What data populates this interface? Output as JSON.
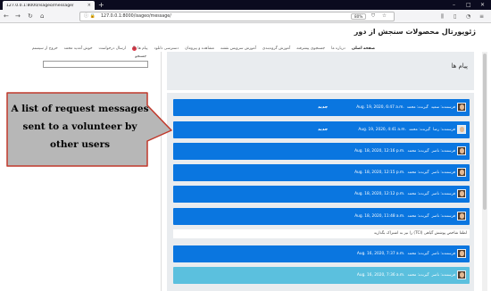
{
  "browser": {
    "tab_title": "127.0.0.1:8000/isageo/message/",
    "url": "127.0.0.1:8000/isageo/message/",
    "zoom": "80%"
  },
  "site": {
    "brand": "ژئوپورتال محصولات سنجش از دور",
    "nav": [
      {
        "label": "صفحه اصلی",
        "active": true
      },
      {
        "label": "درباره ما"
      },
      {
        "label": "جستجوی پیشرفته"
      },
      {
        "label": "آموزش گروه‌بندی"
      },
      {
        "label": "آموزش سرویس نقشه"
      },
      {
        "label": "مشاهده و پیرومان"
      },
      {
        "label": "دسترسی دانلود"
      },
      {
        "label": "پیام ها",
        "badge": "5"
      },
      {
        "label": "ارسال درخواست"
      },
      {
        "label": "خوش آمدید محمد"
      },
      {
        "label": "خروج از سیستم"
      }
    ]
  },
  "sidebar": {
    "search_label": "جستجو",
    "search_value": ""
  },
  "page": {
    "title": "پیام ها"
  },
  "messages": [
    {
      "sender": "فرستنده: سعید",
      "receiver": "گیرنده: محمد",
      "date": "Aug. 19, 2020, 6:47 a.m.",
      "status": "جدید",
      "style": "blue",
      "avatar": "dark"
    },
    {
      "sender": "فرستنده: رضا",
      "receiver": "گیرنده: محمد",
      "date": "Aug. 19, 2020, 4:41 a.m.",
      "status": "جدید",
      "style": "blue",
      "avatar": "light"
    },
    {
      "sender": "فرستنده: ناصر",
      "receiver": "گیرنده: محمد",
      "date": "Aug. 18, 2020, 12:16 p.m.",
      "status": "",
      "style": "blue",
      "avatar": "dark"
    },
    {
      "sender": "فرستنده: ناصر",
      "receiver": "گیرنده: محمد",
      "date": "Aug. 18, 2020, 12:15 p.m.",
      "status": "",
      "style": "blue",
      "avatar": "dark"
    },
    {
      "sender": "فرستنده: ناصر",
      "receiver": "گیرنده: محمد",
      "date": "Aug. 18, 2020, 12:12 p.m.",
      "status": "",
      "style": "blue",
      "avatar": "dark"
    },
    {
      "sender": "فرستنده: ناصر",
      "receiver": "گیرنده: محمد",
      "date": "Aug. 18, 2020, 11:48 a.m.",
      "status": "",
      "style": "blue",
      "avatar": "dark"
    },
    {
      "sender": "فرستنده: ناصر",
      "receiver": "گیرنده: محمد",
      "date": "Aug. 16, 2020, 7:37 a.m.",
      "status": "",
      "style": "blue",
      "avatar": "dark"
    },
    {
      "sender": "فرستنده: ناصر",
      "receiver": "گیرنده: محمد",
      "date": "Aug. 16, 2020, 7:36 a.m.",
      "status": "",
      "style": "cyan",
      "avatar": "dark"
    }
  ],
  "expanded_message_text": "لطفا شاخص پوشش گیاهی (TCI) را نیز به اشتراک بگذارید",
  "callout": {
    "lines": [
      "A list of request messages",
      "sent to a volunteer by",
      "other users"
    ],
    "fill": "#b7b7b7",
    "border": "#c0392b"
  },
  "colors": {
    "message_blue": "#0a76e0",
    "message_cyan": "#5bc0de",
    "panel_gray": "#e9ecef"
  }
}
